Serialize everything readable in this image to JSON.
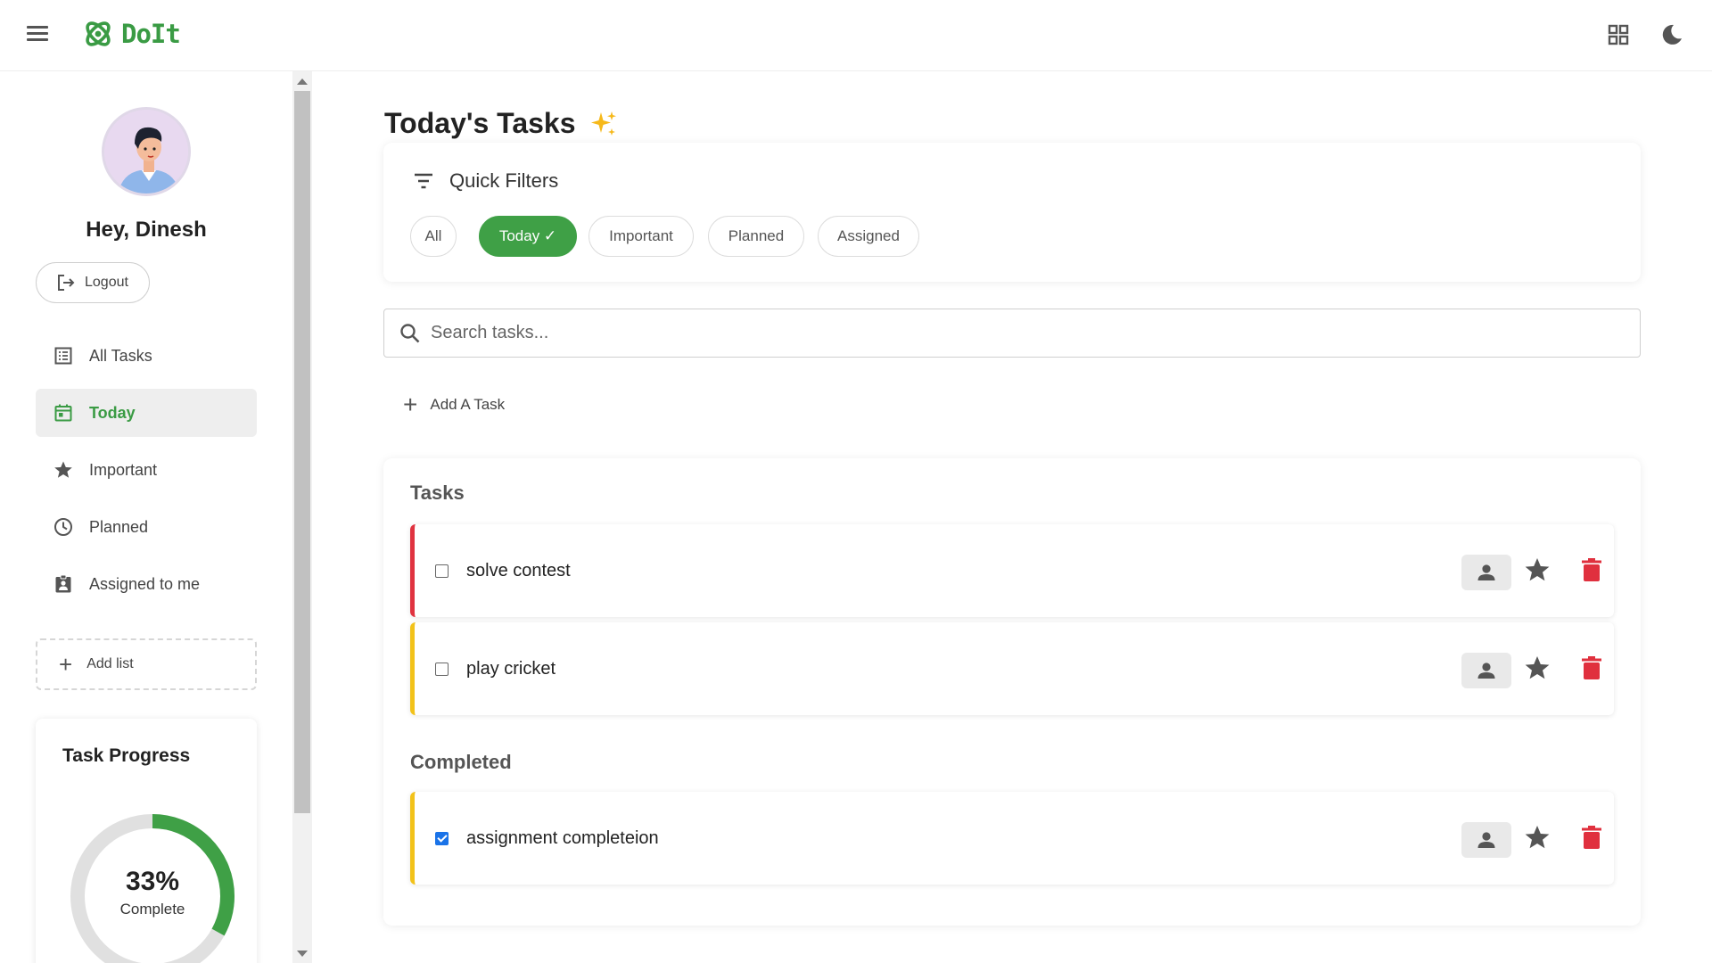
{
  "app": {
    "name": "DoIt",
    "brand_color": "#3a9b44"
  },
  "header": {
    "menu_icon": "hamburger-menu-icon",
    "right_icons": [
      "grid-view-icon",
      "dark-mode-moon-icon"
    ]
  },
  "sidebar": {
    "greeting": "Hey, Dinesh",
    "logout_label": "Logout",
    "nav": [
      {
        "label": "All Tasks",
        "icon": "list-icon",
        "active": false
      },
      {
        "label": "Today",
        "icon": "calendar-today-icon",
        "active": true
      },
      {
        "label": "Important",
        "icon": "star-icon",
        "active": false
      },
      {
        "label": "Planned",
        "icon": "clock-icon",
        "active": false
      },
      {
        "label": "Assigned to me",
        "icon": "assignment-ind-icon",
        "active": false
      }
    ],
    "add_list_label": "Add list",
    "progress": {
      "title": "Task Progress",
      "percent_label": "33%",
      "percent_value": 33,
      "complete_label": "Complete"
    }
  },
  "main": {
    "title": "Today's Tasks",
    "filters": {
      "heading": "Quick Filters",
      "chips": [
        {
          "label": "All",
          "active": false
        },
        {
          "label": "Today ✓",
          "active": true
        },
        {
          "label": "Important",
          "active": false
        },
        {
          "label": "Planned",
          "active": false
        },
        {
          "label": "Assigned",
          "active": false
        }
      ]
    },
    "search": {
      "placeholder": "Search tasks...",
      "value": ""
    },
    "add_task_label": "Add A Task",
    "tasks_heading": "Tasks",
    "completed_heading": "Completed",
    "tasks": [
      {
        "text": "solve contest",
        "done": false,
        "priority_color": "#e03340"
      },
      {
        "text": "play cricket",
        "done": false,
        "priority_color": "#f2c21a"
      }
    ],
    "completed": [
      {
        "text": "assignment completeion",
        "done": true,
        "priority_color": "#f2c21a"
      }
    ],
    "colors": {
      "accent": "#3fa046",
      "delete": "#e0303e",
      "checkbox": "#1a73e8"
    }
  }
}
